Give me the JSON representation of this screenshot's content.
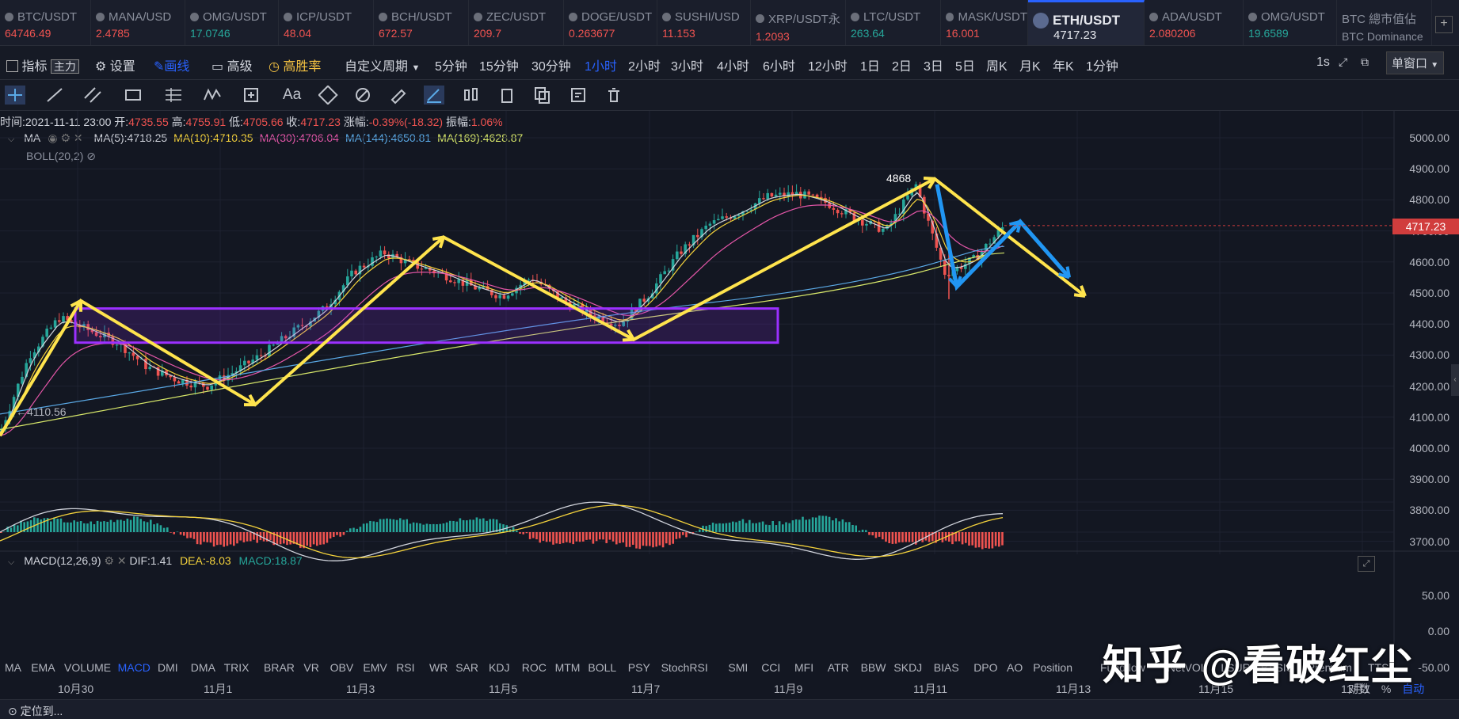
{
  "tickers": [
    {
      "sym": "BTC/USDT",
      "price": "64746.49",
      "dir": "dn"
    },
    {
      "sym": "MANA/USD",
      "price": "2.4785",
      "dir": "dn"
    },
    {
      "sym": "OMG/USDT",
      "price": "17.0746",
      "dir": "up"
    },
    {
      "sym": "ICP/USDT",
      "price": "48.04",
      "dir": "dn"
    },
    {
      "sym": "BCH/USDT",
      "price": "672.57",
      "dir": "dn"
    },
    {
      "sym": "ZEC/USDT",
      "price": "209.7",
      "dir": "dn"
    },
    {
      "sym": "DOGE/USDT",
      "price": "0.263677",
      "dir": "dn"
    },
    {
      "sym": "SUSHI/USD",
      "price": "11.153",
      "dir": "dn"
    },
    {
      "sym": "XRP/USDT永",
      "price": "1.2093",
      "dir": "dn"
    },
    {
      "sym": "LTC/USDT",
      "price": "263.64",
      "dir": "up"
    },
    {
      "sym": "MASK/USDT",
      "price": "16.001",
      "dir": "dn"
    },
    {
      "sym": "ETH/USDT",
      "price": "4717.23",
      "dir": "active"
    },
    {
      "sym": "ADA/USDT",
      "price": "2.080206",
      "dir": "dn"
    },
    {
      "sym": "OMG/USDT",
      "price": "19.6589",
      "dir": "up"
    },
    {
      "sym": "BTC 總市值佔",
      "price": "BTC Dominance",
      "dir": "plain"
    }
  ],
  "toolbar": {
    "indicator": "指标",
    "main_tag": "主力",
    "settings": "设置",
    "draw": "画线",
    "advanced": "高级",
    "win_rate": "高胜率",
    "custom_period": "自定义周期",
    "periods": [
      "5分钟",
      "15分钟",
      "30分钟",
      "1小时",
      "2小时",
      "3小时",
      "4小时",
      "6小时",
      "12小时",
      "1日",
      "2日",
      "3日",
      "5日",
      "周K",
      "月K",
      "年K",
      "1分钟"
    ],
    "active_period": "1小时",
    "interval": "1s",
    "window": "单窗口"
  },
  "ohlc": {
    "time_label": "时间:",
    "time": "2021-11-11 23:00",
    "open_label": "开:",
    "open": "4735.55",
    "high_label": "高:",
    "high": "4755.91",
    "low_label": "低:",
    "low": "4705.66",
    "close_label": "收:",
    "close": "4717.23",
    "chg_label": "涨幅:",
    "chg": "-0.39%(-18.32)",
    "amp_label": "振幅:",
    "amp": "1.06%"
  },
  "ma_legend": {
    "name": "MA",
    "items": [
      {
        "label": "MA(5):4718.25",
        "color": "#d1d4dc"
      },
      {
        "label": "MA(10):4710.35",
        "color": "#f5d33c"
      },
      {
        "label": "MA(30):4706.04",
        "color": "#e456a8"
      },
      {
        "label": "MA(144):4650.81",
        "color": "#5aa9e6"
      },
      {
        "label": "MA(169):4628.87",
        "color": "#d8e86a"
      }
    ],
    "boll": "BOLL(20,2)"
  },
  "price_axis": [
    "5000.00",
    "4900.00",
    "4800.00",
    "4700.00",
    "4600.00",
    "4500.00",
    "4400.00",
    "4300.00",
    "4200.00",
    "4100.00",
    "4000.00",
    "3900.00",
    "3800.00",
    "3700.00"
  ],
  "current_price": "4717.23",
  "annotations": {
    "peak": "4868",
    "low": "4110.56"
  },
  "macd_legend": {
    "name": "MACD(12,26,9)",
    "dif": "DIF:1.41",
    "dea": "DEA:-8.03",
    "macd": "MACD:18.87"
  },
  "macd_axis": [
    "50.00",
    "0.00",
    "-50.00"
  ],
  "indicators": [
    "MA",
    "EMA",
    "VOLUME",
    "MACD",
    "DMI",
    "DMA",
    "TRIX",
    "BRAR",
    "VR",
    "OBV",
    "EMV",
    "RSI",
    "WR",
    "SAR",
    "KDJ",
    "ROC",
    "MTM",
    "BOLL",
    "PSY",
    "StochRSI",
    "SMI",
    "CCI",
    "MFI",
    "ATR",
    "BBW",
    "SKDJ",
    "BIAS",
    "DPO",
    "AO",
    "Position",
    "Fundflow",
    "NetVOL",
    "LSUR",
    "BASIS",
    "Premium",
    "TTS"
  ],
  "active_indicator": "MACD",
  "x_axis": [
    "10月30",
    "11月1",
    "11月3",
    "11月5",
    "11月7",
    "11月9",
    "11月11",
    "11月13",
    "11月15",
    "11月1"
  ],
  "scale_opts": {
    "log": "对数",
    "pct": "%",
    "auto": "自动"
  },
  "locate": "定位到...",
  "watermark": "知乎 @看破红尘",
  "colors": {
    "bg": "#131722",
    "accent": "#2962ff",
    "up": "#26a69a",
    "down": "#ef5350",
    "yellow_line": "#ffe44d",
    "blue_line": "#2196f3",
    "purple_box": "#8a2be2"
  },
  "chart_data": {
    "type": "candlestick",
    "symbol": "ETH/USDT",
    "interval": "1小时",
    "ylim": [
      3650,
      5050
    ],
    "close_path": [
      [
        "10月29",
        4050
      ],
      [
        "10月29",
        4300
      ],
      [
        "10月30",
        4420
      ],
      [
        "10月30",
        4380
      ],
      [
        "10月31",
        4340
      ],
      [
        "10月31",
        4260
      ],
      [
        "11月1",
        4220
      ],
      [
        "11月1",
        4200
      ],
      [
        "11月1",
        4250
      ],
      [
        "11月2",
        4310
      ],
      [
        "11月2",
        4380
      ],
      [
        "11月3",
        4450
      ],
      [
        "11月3",
        4570
      ],
      [
        "11月3",
        4630
      ],
      [
        "11月4",
        4590
      ],
      [
        "11月4",
        4560
      ],
      [
        "11月5",
        4520
      ],
      [
        "11月5",
        4490
      ],
      [
        "11月6",
        4550
      ],
      [
        "11月6",
        4480
      ],
      [
        "11月7",
        4430
      ],
      [
        "11月7",
        4400
      ],
      [
        "11月7",
        4500
      ],
      [
        "11月8",
        4630
      ],
      [
        "11月8",
        4720
      ],
      [
        "11月8",
        4760
      ],
      [
        "11月9",
        4810
      ],
      [
        "11月9",
        4820
      ],
      [
        "11月10",
        4790
      ],
      [
        "11月10",
        4740
      ],
      [
        "11月10",
        4700
      ],
      [
        "11月11",
        4850
      ],
      [
        "11月11",
        4560
      ],
      [
        "11月11",
        4610
      ],
      [
        "11月11",
        4717.23
      ]
    ],
    "drawings": [
      {
        "type": "zigzag",
        "color": "yellow",
        "points": [
          [
            4050
          ],
          [
            4470
          ],
          [
            4140
          ],
          [
            4680
          ],
          [
            4350
          ],
          [
            4868
          ],
          [
            4490
          ]
        ]
      },
      {
        "type": "zigzag",
        "color": "blue",
        "points": [
          [
            4850
          ],
          [
            4520
          ],
          [
            4730
          ],
          [
            4550
          ]
        ]
      },
      {
        "type": "rectangle",
        "color": "purple",
        "price_top": 4450,
        "price_bottom": 4340
      }
    ]
  }
}
